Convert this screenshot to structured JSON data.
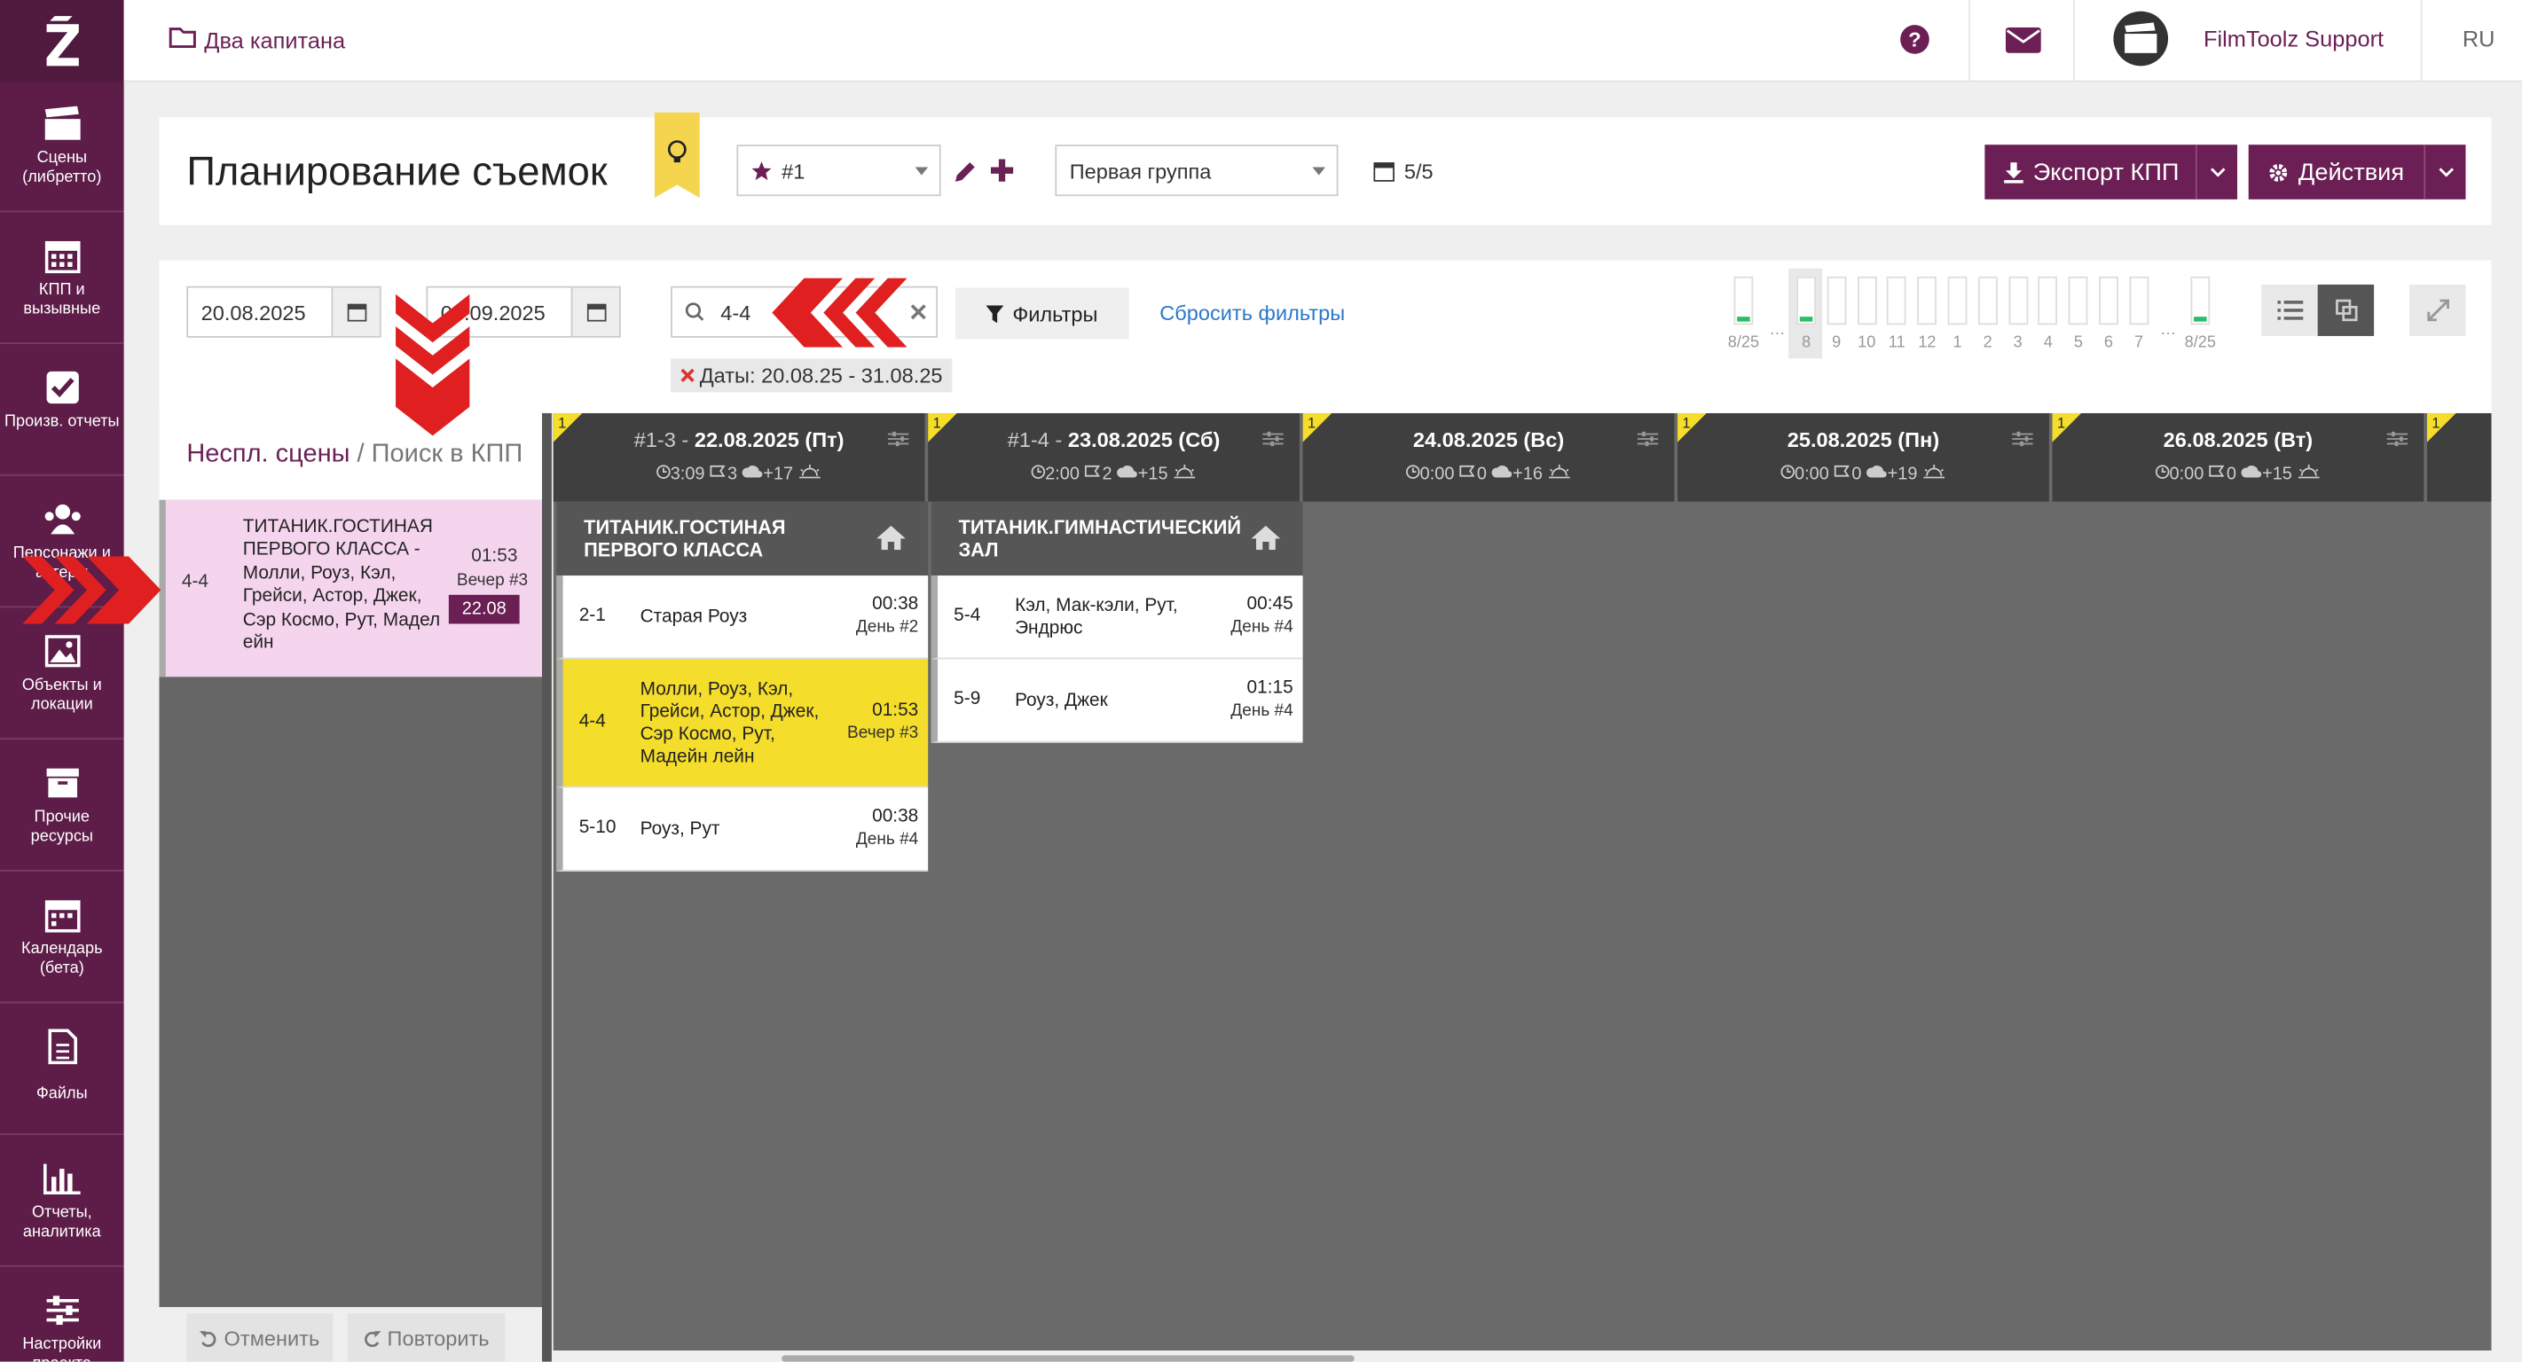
{
  "app": {
    "project": "Два капитана",
    "user": "FilmToolz Support",
    "lang": "RU"
  },
  "nav": [
    {
      "label": "Сцены (либретто)",
      "icon": "clapperboard-icon"
    },
    {
      "label": "КПП и вызывные",
      "icon": "calendar-grid-icon"
    },
    {
      "label": "Произв. отчеты",
      "icon": "check-square-icon"
    },
    {
      "label": "Персонажи и актеры",
      "icon": "people-icon"
    },
    {
      "label": "Объекты и локации",
      "icon": "image-icon"
    },
    {
      "label": "Прочие ресурсы",
      "icon": "archive-icon"
    },
    {
      "label": "Календарь (бета)",
      "icon": "calendar-icon"
    },
    {
      "label": "Файлы",
      "icon": "file-icon"
    },
    {
      "label": "Отчеты, аналитика",
      "icon": "bar-chart-icon"
    },
    {
      "label": "Настройки проекта",
      "icon": "sliders-icon"
    }
  ],
  "header": {
    "title": "Планирование съемок",
    "version": "#1",
    "group": "Первая группа",
    "days_count": "5/5",
    "export_label": "Экспорт КПП",
    "actions_label": "Действия"
  },
  "filters": {
    "date_from": "20.08.2025",
    "date_to": "03.09.2025",
    "search_value": "4-4",
    "filter_btn": "Фильтры",
    "reset": "Сбросить фильтры",
    "chip": "Даты: 20.08.25 - 31.08.25",
    "gauges": {
      "left_label": "8/25",
      "right_label": "8/25",
      "days": [
        "8",
        "9",
        "10",
        "11",
        "12",
        "1",
        "2",
        "3",
        "4",
        "5",
        "6",
        "7"
      ]
    }
  },
  "leftpanel": {
    "tab_active": "Неспл. сцены",
    "separator": "/",
    "tab_other": "Поиск в КПП",
    "card": {
      "no": "4-4",
      "desc": "ТИТАНИК.ГОСТИНАЯ ПЕРВОГО КЛАССА - Молли, Роуз, Кэл, Грейси, Астор, Джек, Сэр Космо, Рут, Мадел​ейн",
      "time": "01:53",
      "slot": "Вечер #3",
      "date": "22.08"
    },
    "undo": "Отменить",
    "redo": "Повторить"
  },
  "days": [
    {
      "n": "1",
      "prefix": "#1-3 - ",
      "date": "22.08.2025 (Пт)",
      "time": "3:09",
      "scenes": "3",
      "weather": "+17"
    },
    {
      "n": "1",
      "prefix": "#1-4 - ",
      "date": "23.08.2025 (Сб)",
      "time": "2:00",
      "scenes": "2",
      "weather": "+15"
    },
    {
      "n": "1",
      "prefix": "",
      "date": "24.08.2025 (Вс)",
      "time": "0:00",
      "scenes": "0",
      "weather": "+16"
    },
    {
      "n": "1",
      "prefix": "",
      "date": "25.08.2025 (Пн)",
      "time": "0:00",
      "scenes": "0",
      "weather": "+19"
    },
    {
      "n": "1",
      "prefix": "",
      "date": "26.08.2025 (Вт)",
      "time": "0:00",
      "scenes": "0",
      "weather": "+15"
    },
    {
      "n": "1"
    }
  ],
  "locations": [
    {
      "name": "ТИТАНИК.ГОСТИНАЯ ПЕРВОГО КЛАССА",
      "scenes": [
        {
          "no": "2-1",
          "desc": "Старая Роуз",
          "time": "00:38",
          "slot": "День #2"
        },
        {
          "no": "4-4",
          "desc": "Молли, Роуз, Кэл, Грейси, Астор, Джек, Сэр Космо, Рут, Мадейн лейн",
          "time": "01:53",
          "slot": "Вечер #3"
        },
        {
          "no": "5-10",
          "desc": "Роуз, Рут",
          "time": "00:38",
          "slot": "День #4"
        }
      ]
    },
    {
      "name": "ТИТАНИК.ГИМНАСТИЧЕСКИЙ ЗАЛ",
      "scenes": [
        {
          "no": "5-4",
          "desc": "Кэл, Мак-кэли, Рут, Эндрюс",
          "time": "00:45",
          "slot": "День #4"
        },
        {
          "no": "5-9",
          "desc": "Роуз, Джек",
          "time": "01:15",
          "slot": "День #4"
        }
      ]
    }
  ],
  "colors": {
    "brand": "#6b1f55",
    "highlight": "#f5dd2b",
    "pink": "#f5d5ee",
    "arrow": "#e02020"
  }
}
